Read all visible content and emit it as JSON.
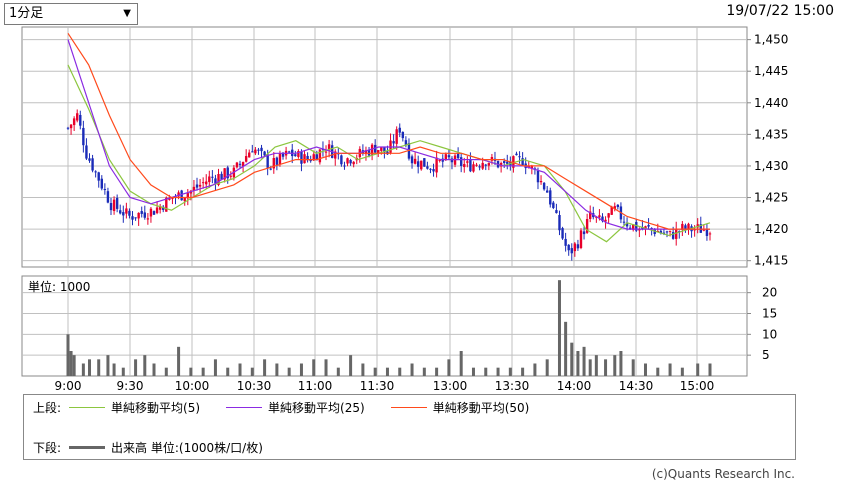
{
  "controls": {
    "interval_select": "1分足",
    "timestamp": "19/07/22 15:00"
  },
  "legend": {
    "upper_label": "上段:",
    "lower_label": "下段:",
    "ma5": "単純移動平均(5)",
    "ma25": "単純移動平均(25)",
    "ma50": "単純移動平均(50)",
    "volume": "出来高 単位:(1000株/口/枚)"
  },
  "credit": "(c)Quants Research Inc.",
  "colors": {
    "up": "#e8002a",
    "down": "#1a2bb8",
    "ma5": "#8cc63f",
    "ma25": "#8b2be2",
    "ma50": "#ff4a1c",
    "volume": "#666666",
    "grid": "#c0c0c0"
  },
  "chart_data": [
    {
      "type": "candlestick",
      "x_ticks": [
        "9:00",
        "9:30",
        "10:00",
        "10:30",
        "11:00",
        "11:30",
        "13:00",
        "13:30",
        "14:00",
        "14:30",
        "15:00"
      ],
      "y_ticks": [
        "1,415",
        "1,420",
        "1,425",
        "1,430",
        "1,435",
        "1,440",
        "1,445",
        "1,450"
      ],
      "ylim": [
        1414,
        1452
      ],
      "n_bars": 210,
      "ohlc_anchor_closes": [
        [
          0,
          1436
        ],
        [
          3,
          1438
        ],
        [
          6,
          1432
        ],
        [
          10,
          1428
        ],
        [
          14,
          1424
        ],
        [
          20,
          1422
        ],
        [
          28,
          1423
        ],
        [
          34,
          1425
        ],
        [
          40,
          1426
        ],
        [
          46,
          1428
        ],
        [
          54,
          1429
        ],
        [
          60,
          1433
        ],
        [
          66,
          1430
        ],
        [
          72,
          1432
        ],
        [
          78,
          1431
        ],
        [
          84,
          1433
        ],
        [
          90,
          1431
        ],
        [
          96,
          1432
        ],
        [
          100,
          1433
        ],
        [
          104,
          1432
        ],
        [
          108,
          1436
        ],
        [
          112,
          1431
        ],
        [
          118,
          1430
        ],
        [
          124,
          1431
        ],
        [
          130,
          1430
        ],
        [
          136,
          1431
        ],
        [
          142,
          1430
        ],
        [
          148,
          1431
        ],
        [
          152,
          1429
        ],
        [
          156,
          1426
        ],
        [
          160,
          1420
        ],
        [
          163,
          1416
        ],
        [
          166,
          1418
        ],
        [
          170,
          1422
        ],
        [
          174,
          1421
        ],
        [
          178,
          1423
        ],
        [
          182,
          1421
        ],
        [
          186,
          1420
        ],
        [
          190,
          1420
        ],
        [
          196,
          1419
        ],
        [
          200,
          1420
        ],
        [
          205,
          1420
        ],
        [
          209,
          1420
        ]
      ],
      "series": [
        {
          "name": "単純移動平均(5)",
          "values": [
            1446,
            1439,
            1431,
            1426,
            1424,
            1423,
            1425,
            1427,
            1428,
            1430,
            1433,
            1434,
            1432,
            1433,
            1431,
            1432,
            1433,
            1434,
            1433,
            1432,
            1431,
            1430,
            1431,
            1430,
            1426,
            1420,
            1418,
            1421,
            1420,
            1419,
            1420,
            1421
          ]
        },
        {
          "name": "単純移動平均(25)",
          "values": [
            1450,
            1440,
            1430,
            1425,
            1424,
            1425,
            1426,
            1427,
            1429,
            1431,
            1432,
            1432,
            1433,
            1432,
            1432,
            1433,
            1433,
            1432,
            1431,
            1431,
            1431,
            1430,
            1430,
            1429,
            1426,
            1423,
            1421,
            1420,
            1420,
            1420,
            1420,
            1420
          ]
        },
        {
          "name": "単純移動平均(50)",
          "values": [
            1451,
            1446,
            1438,
            1431,
            1427,
            1425,
            1425,
            1426,
            1427,
            1429,
            1430,
            1431,
            1431,
            1432,
            1432,
            1432,
            1432,
            1433,
            1432,
            1432,
            1431,
            1431,
            1430,
            1430,
            1428,
            1426,
            1424,
            1422,
            1421,
            1420,
            1420,
            1420
          ]
        }
      ]
    },
    {
      "type": "bar",
      "title": "単位: 1000",
      "y_ticks": [
        "5",
        "10",
        "15",
        "20"
      ],
      "ylim": [
        0,
        24
      ],
      "volumes_sparse": [
        [
          0,
          10
        ],
        [
          1,
          6
        ],
        [
          2,
          5
        ],
        [
          5,
          3
        ],
        [
          7,
          4
        ],
        [
          10,
          4
        ],
        [
          13,
          5
        ],
        [
          15,
          3
        ],
        [
          18,
          2
        ],
        [
          22,
          4
        ],
        [
          25,
          5
        ],
        [
          28,
          3
        ],
        [
          32,
          2
        ],
        [
          36,
          7
        ],
        [
          40,
          2
        ],
        [
          44,
          2
        ],
        [
          48,
          4
        ],
        [
          52,
          2
        ],
        [
          56,
          3
        ],
        [
          60,
          2
        ],
        [
          64,
          4
        ],
        [
          68,
          3
        ],
        [
          72,
          2
        ],
        [
          76,
          3
        ],
        [
          80,
          4
        ],
        [
          84,
          4
        ],
        [
          88,
          2
        ],
        [
          92,
          5
        ],
        [
          96,
          3
        ],
        [
          100,
          2
        ],
        [
          104,
          2
        ],
        [
          108,
          2
        ],
        [
          112,
          3
        ],
        [
          116,
          2
        ],
        [
          120,
          2
        ],
        [
          124,
          4
        ],
        [
          128,
          6
        ],
        [
          132,
          2
        ],
        [
          136,
          2
        ],
        [
          140,
          2
        ],
        [
          144,
          2
        ],
        [
          148,
          2
        ],
        [
          152,
          3
        ],
        [
          156,
          4
        ],
        [
          160,
          23
        ],
        [
          162,
          13
        ],
        [
          164,
          8
        ],
        [
          166,
          6
        ],
        [
          168,
          7
        ],
        [
          170,
          4
        ],
        [
          172,
          5
        ],
        [
          175,
          4
        ],
        [
          178,
          5
        ],
        [
          180,
          6
        ],
        [
          184,
          4
        ],
        [
          188,
          3
        ],
        [
          192,
          2
        ],
        [
          196,
          3
        ],
        [
          200,
          2
        ],
        [
          205,
          3
        ],
        [
          209,
          3
        ]
      ]
    }
  ]
}
